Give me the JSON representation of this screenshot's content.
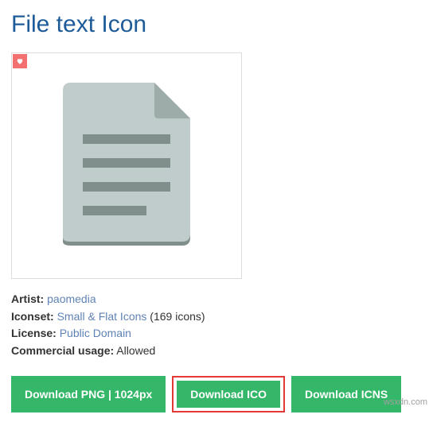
{
  "title": "File text Icon",
  "meta": {
    "artist_label": "Artist:",
    "artist_value": "paomedia",
    "iconset_label": "Iconset:",
    "iconset_value": "Small & Flat Icons",
    "iconset_count": "(169 icons)",
    "license_label": "License:",
    "license_value": "Public Domain",
    "commercial_label": "Commercial usage:",
    "commercial_value": "Allowed"
  },
  "buttons": {
    "png": "Download PNG | 1024px",
    "ico": "Download ICO",
    "icns": "Download ICNS"
  },
  "watermark": "wsxdn.com"
}
